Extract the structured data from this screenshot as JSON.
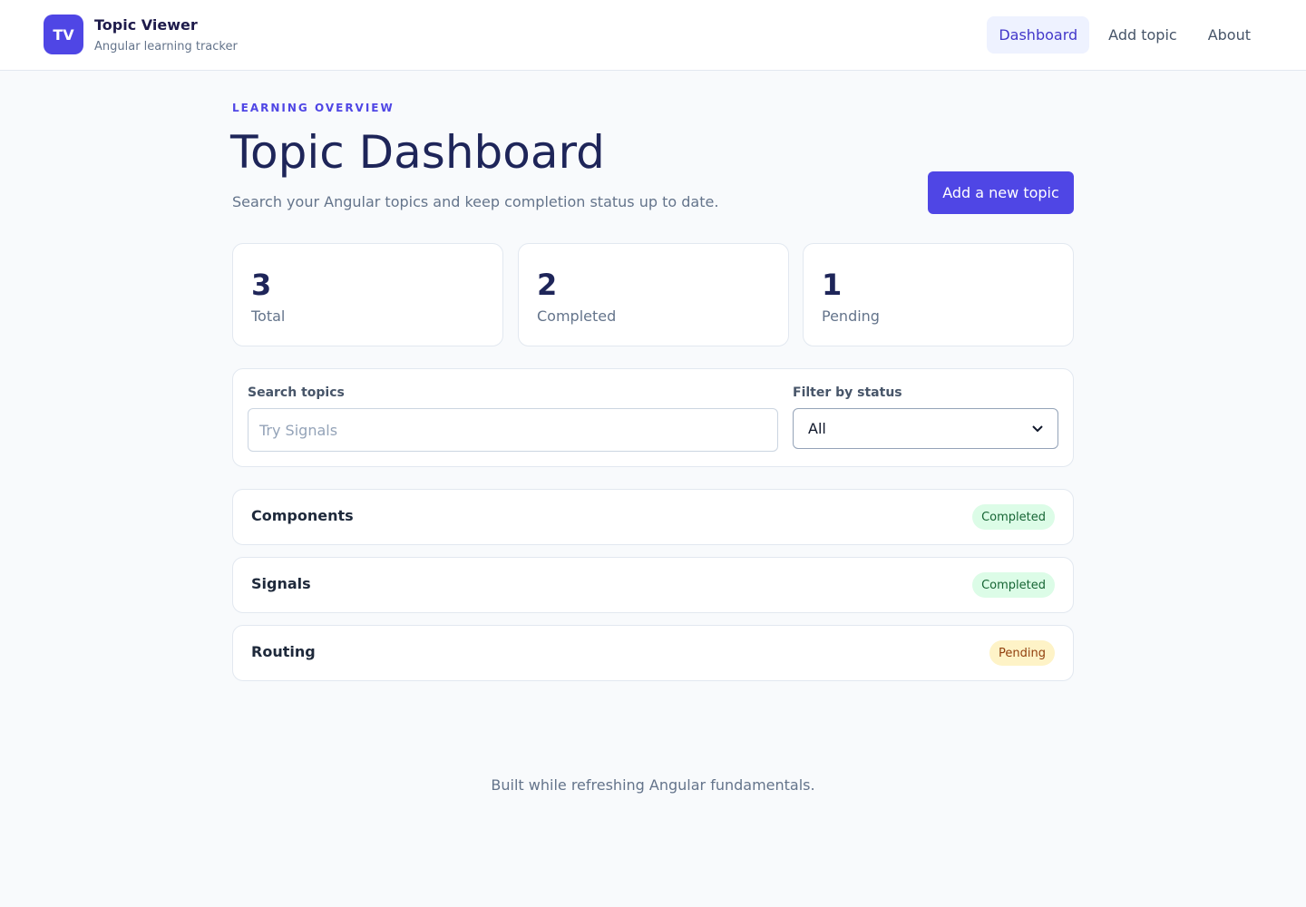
{
  "app": {
    "logo_initials": "TV",
    "title": "Topic Viewer",
    "subtitle": "Angular learning tracker"
  },
  "nav": {
    "items": [
      {
        "label": "Dashboard",
        "active": true
      },
      {
        "label": "Add topic",
        "active": false
      },
      {
        "label": "About",
        "active": false
      }
    ]
  },
  "header": {
    "eyebrow": "LEARNING OVERVIEW",
    "title": "Topic Dashboard",
    "description": "Search your Angular topics and keep completion status up to date.",
    "add_button_label": "Add a new topic"
  },
  "stats": [
    {
      "value": "3",
      "label": "Total"
    },
    {
      "value": "2",
      "label": "Completed"
    },
    {
      "value": "1",
      "label": "Pending"
    }
  ],
  "filters": {
    "search_label": "Search topics",
    "search_placeholder": "Try Signals",
    "search_value": "",
    "status_label": "Filter by status",
    "status_selected": "All"
  },
  "topics": [
    {
      "name": "Components",
      "status": "Completed"
    },
    {
      "name": "Signals",
      "status": "Completed"
    },
    {
      "name": "Routing",
      "status": "Pending"
    }
  ],
  "footer": {
    "text": "Built while refreshing Angular fundamentals."
  },
  "colors": {
    "accent": "#4f46e5",
    "completed_bg": "#dcfce7",
    "completed_text": "#166534",
    "pending_bg": "#fef3c7",
    "pending_text": "#92400e"
  }
}
